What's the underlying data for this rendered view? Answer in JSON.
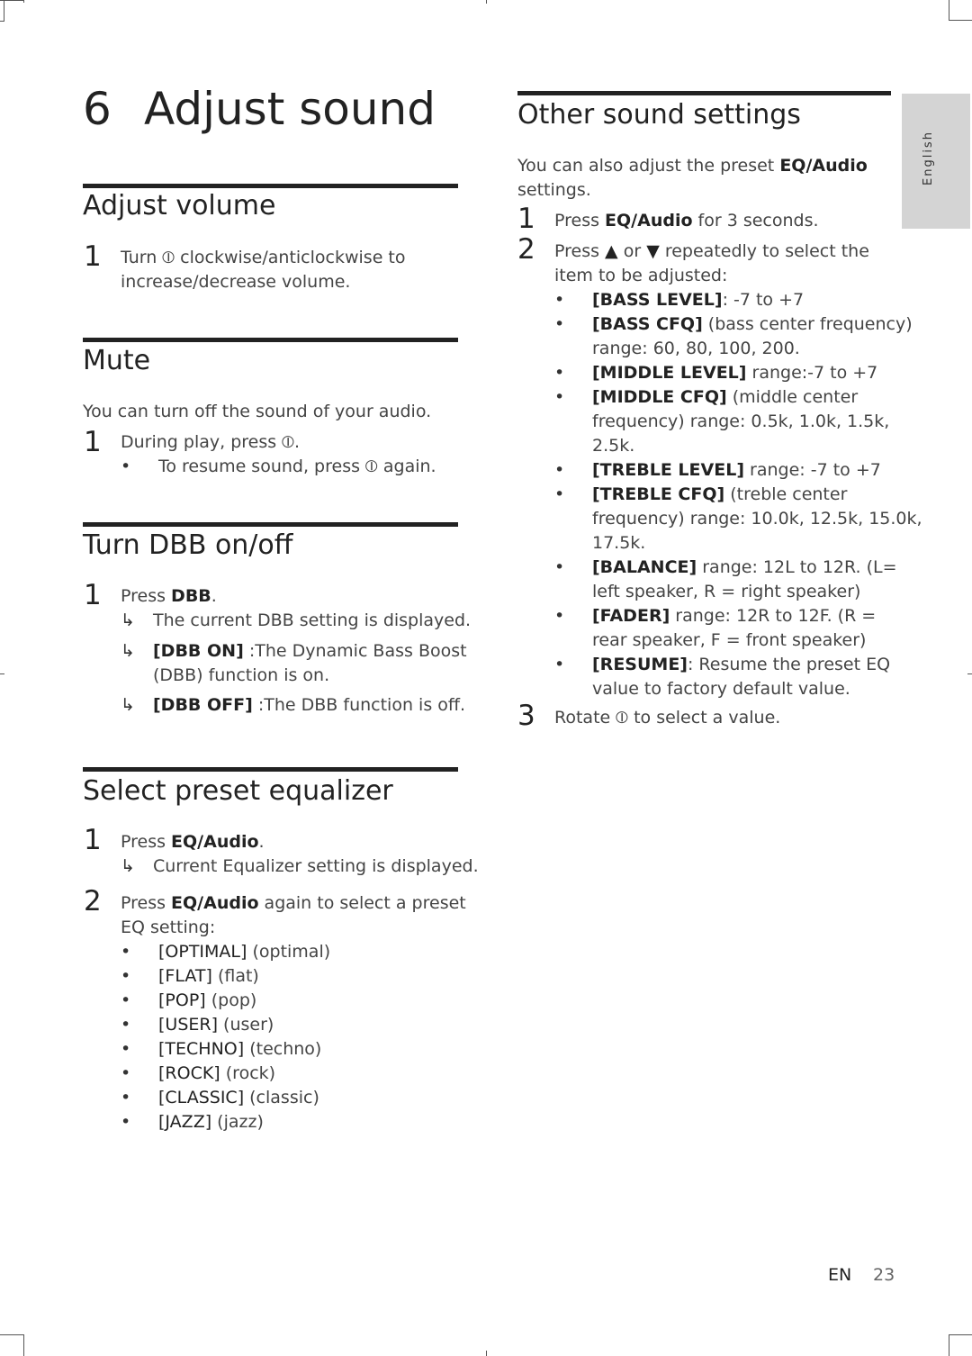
{
  "chapter": {
    "number": "6",
    "title": "Adjust sound"
  },
  "side_tab": {
    "label": "English"
  },
  "sections": {
    "adjust_volume": {
      "heading": "Adjust volume",
      "steps": [
        {
          "num": "1",
          "line1": "Turn ⦶ clockwise/anticlockwise to",
          "line2": "increase/decrease volume."
        }
      ]
    },
    "mute": {
      "heading": "Mute",
      "intro": "You can turn off the sound of your audio.",
      "steps": [
        {
          "num": "1",
          "text": "During play, press ⦶."
        }
      ],
      "bullets": [
        "To resume sound, press ⦶ again."
      ]
    },
    "dbb": {
      "heading": "Turn DBB on/off",
      "steps": [
        {
          "num": "1",
          "prefix": "Press ",
          "key": "DBB",
          "suffix": "."
        }
      ],
      "results": [
        {
          "key": "",
          "text": "The current DBB setting is displayed."
        },
        {
          "key": "[DBB ON]",
          "text": " :The Dynamic Bass Boost",
          "line2": "(DBB) function is on."
        },
        {
          "key": "[DBB OFF]",
          "text": " :The DBB function is off."
        }
      ]
    },
    "eq": {
      "heading": "Select preset equalizer",
      "step1": {
        "num": "1",
        "prefix": "Press ",
        "key": "EQ/Audio",
        "suffix": ".",
        "result": "Current Equalizer setting is displayed."
      },
      "step2": {
        "num": "2",
        "prefix": "Press ",
        "key": "EQ/Audio",
        "suffix": " again to select a preset",
        "line2": "EQ setting:"
      },
      "options": [
        {
          "key": "[OPTIMAL]",
          "desc": " (optimal)"
        },
        {
          "key": "[FLAT]",
          "desc": " (flat)"
        },
        {
          "key": "[POP]",
          "desc": " (pop)"
        },
        {
          "key": "[USER]",
          "desc": " (user)"
        },
        {
          "key": "[TECHNO]",
          "desc": " (techno)"
        },
        {
          "key": "[ROCK]",
          "desc": " (rock)"
        },
        {
          "key": "[CLASSIC]",
          "desc": " (classic)"
        },
        {
          "key": "[JAZZ]",
          "desc": " (jazz)"
        }
      ]
    },
    "other": {
      "heading": "Other sound settings",
      "intro_prefix": "You can also adjust the preset ",
      "intro_key": "EQ/Audio",
      "intro_line2": "settings.",
      "step1": {
        "num": "1",
        "prefix": "Press ",
        "key": "EQ/Audio",
        "suffix": " for 3 seconds."
      },
      "step2": {
        "num": "2",
        "prefix": "Press ",
        "up": "▲",
        "mid": " or ",
        "down": "▼",
        "suffix": " repeatedly to select the",
        "line2": "item to be adjusted:"
      },
      "items": [
        {
          "key": "[BASS LEVEL]",
          "text": ": -7 to +7",
          "line2": "",
          "line3": ""
        },
        {
          "key": "[BASS CFQ]",
          "text": " (bass center frequency)",
          "line2": "range: 60, 80, 100, 200.",
          "line3": ""
        },
        {
          "key": "[MIDDLE LEVEL]",
          "text": " range:-7 to +7",
          "line2": "",
          "line3": ""
        },
        {
          "key": "[MIDDLE CFQ]",
          "text": " (middle center",
          "line2": "frequency) range: 0.5k, 1.0k, 1.5k,",
          "line3": "2.5k."
        },
        {
          "key": "[TREBLE LEVEL]",
          "text": " range: -7 to +7",
          "line2": "",
          "line3": ""
        },
        {
          "key": "[TREBLE CFQ]",
          "text": " (treble center",
          "line2": "frequency) range: 10.0k, 12.5k, 15.0k,",
          "line3": "17.5k."
        },
        {
          "key": "[BALANCE]",
          "text": " range: 12L to 12R. (L=",
          "line2": "left speaker, R = right speaker)",
          "line3": ""
        },
        {
          "key": "[FADER]",
          "text": " range: 12R to 12F. (R =",
          "line2": "rear speaker, F = front speaker)",
          "line3": ""
        },
        {
          "key": "[RESUME]",
          "text": ": Resume the preset EQ",
          "line2": "value to factory default value.",
          "line3": ""
        }
      ],
      "step3": {
        "num": "3",
        "text": "Rotate ⦶ to select a value."
      }
    }
  },
  "footer": {
    "lang": "EN",
    "page": "23"
  },
  "glyphs": {
    "bullet": "•",
    "arrow": "↳"
  }
}
